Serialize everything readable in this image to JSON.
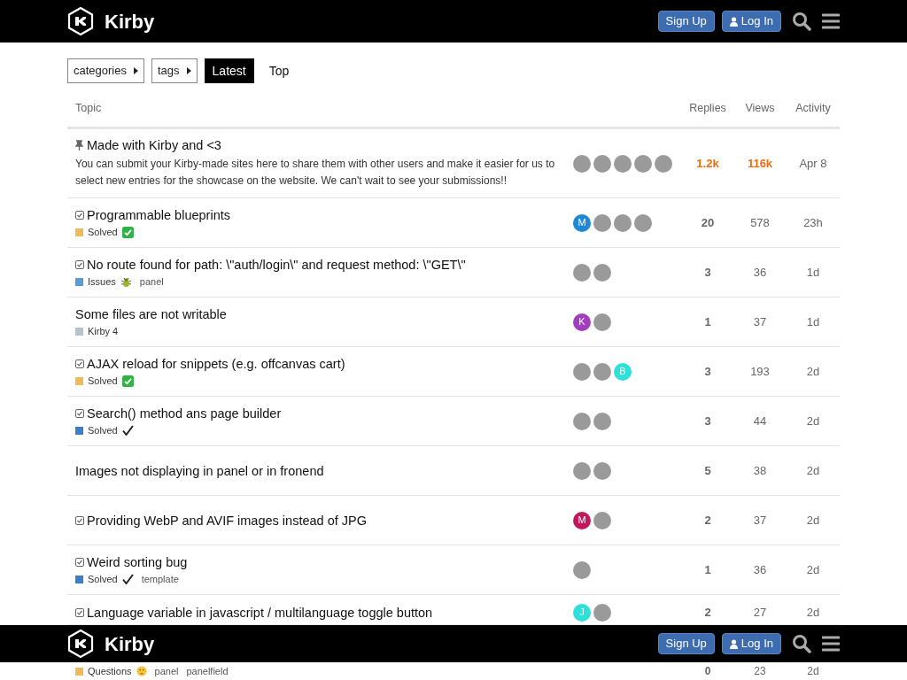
{
  "header": {
    "brand": "Kirby",
    "signup": "Sign Up",
    "login": "Log In"
  },
  "filters": [
    {
      "label": "categories",
      "kind": "dropdown",
      "selected": false
    },
    {
      "label": "tags",
      "kind": "dropdown",
      "selected": false
    },
    {
      "label": "Latest",
      "kind": "tab",
      "selected": true
    },
    {
      "label": "Top",
      "kind": "tab",
      "selected": false
    }
  ],
  "table": {
    "columns": [
      "Topic",
      "Replies",
      "Views",
      "Activity"
    ],
    "rows": [
      {
        "kind": "pinned",
        "title": "Made with Kirby and <3",
        "excerpt": "You can submit your Kirby-made sites here to share them with other users and make it easier for us to select new entries for the showcase on the website. We can't wait to see your submissions!!",
        "posters": [
          {
            "kind": "photo"
          },
          {
            "kind": "photo"
          },
          {
            "kind": "photo"
          },
          {
            "kind": "photo"
          },
          {
            "kind": "photo"
          }
        ],
        "replies": "1.2k",
        "views": "116k",
        "activity": "Apr 8",
        "hot": true
      },
      {
        "kind": "solved",
        "title": "Programmable blueprints",
        "category": {
          "name": "Solved",
          "color": "#f0b95b",
          "kind": "greencheck"
        },
        "posters": [
          {
            "kind": "letter",
            "letter": "M",
            "color": "#1e88d4"
          },
          {
            "kind": "photo"
          },
          {
            "kind": "photo"
          },
          {
            "kind": "photo"
          }
        ],
        "replies": "20",
        "views": "578",
        "activity": "23h",
        "hot": false
      },
      {
        "kind": "solved",
        "title": "No route found for path: \\\"auth/login\\\" and request method: \\\"GET\\\"",
        "category": {
          "name": "Issues",
          "color": "#5b9bd5",
          "kind": "bug"
        },
        "tags": [
          "panel"
        ],
        "posters": [
          {
            "kind": "photo"
          },
          {
            "kind": "photo"
          }
        ],
        "replies": "3",
        "views": "36",
        "activity": "1d",
        "hot": false
      },
      {
        "kind": "open",
        "title": "Some files are not writable",
        "category": {
          "name": "Kirby 4",
          "color": "#b8c2cc",
          "kind": "plain"
        },
        "posters": [
          {
            "kind": "letter",
            "letter": "K",
            "color": "#a23dbf"
          },
          {
            "kind": "photo"
          }
        ],
        "replies": "1",
        "views": "37",
        "activity": "1d",
        "hot": false
      },
      {
        "kind": "solved",
        "title": "AJAX reload for snippets (e.g. offcanvas cart)",
        "category": {
          "name": "Solved",
          "color": "#f0b95b",
          "kind": "greencheck"
        },
        "posters": [
          {
            "kind": "photo"
          },
          {
            "kind": "photo"
          },
          {
            "kind": "letter",
            "letter": "B",
            "color": "#2de0d8"
          }
        ],
        "replies": "3",
        "views": "193",
        "activity": "2d",
        "hot": false
      },
      {
        "kind": "solved",
        "title": "Search() method ans page builder",
        "category": {
          "name": "Solved",
          "color": "#3c7fc9",
          "kind": "check"
        },
        "posters": [
          {
            "kind": "photo"
          },
          {
            "kind": "photo"
          }
        ],
        "replies": "3",
        "views": "44",
        "activity": "2d",
        "hot": false
      },
      {
        "kind": "open",
        "title": "Images not displaying in panel or in fronend",
        "posters": [
          {
            "kind": "photo"
          },
          {
            "kind": "photo"
          }
        ],
        "replies": "5",
        "views": "38",
        "activity": "2d",
        "hot": false
      },
      {
        "kind": "solved",
        "title": "Providing WebP and AVIF images instead of JPG",
        "posters": [
          {
            "kind": "letter",
            "letter": "M",
            "color": "#c2185b"
          },
          {
            "kind": "photo"
          }
        ],
        "replies": "2",
        "views": "37",
        "activity": "2d",
        "hot": false
      },
      {
        "kind": "solved",
        "title": "Weird sorting bug",
        "category": {
          "name": "Solved",
          "color": "#3c7fc9",
          "kind": "check"
        },
        "tags": [
          "template"
        ],
        "posters": [
          {
            "kind": "photo"
          }
        ],
        "replies": "1",
        "views": "36",
        "activity": "2d",
        "hot": false
      },
      {
        "kind": "solved",
        "partial": true,
        "title": "Language variable in javascript / multilanguage toggle button",
        "posters": [
          {
            "kind": "letter",
            "letter": "J",
            "color": "#2de0d8"
          },
          {
            "kind": "photo"
          }
        ],
        "replies": "2",
        "views": "27",
        "activity": "2d",
        "hot": false
      }
    ]
  },
  "repeat_header": {
    "brand": "Kirby",
    "signup": "Sign Up",
    "login": "Log In"
  },
  "partial_row": {
    "category": {
      "name": "Questions",
      "color": "#f0b95b",
      "kind": "thinking"
    },
    "tags": [
      "panel",
      "panelfield"
    ],
    "replies": "0",
    "views": "23",
    "activity": "2d"
  }
}
